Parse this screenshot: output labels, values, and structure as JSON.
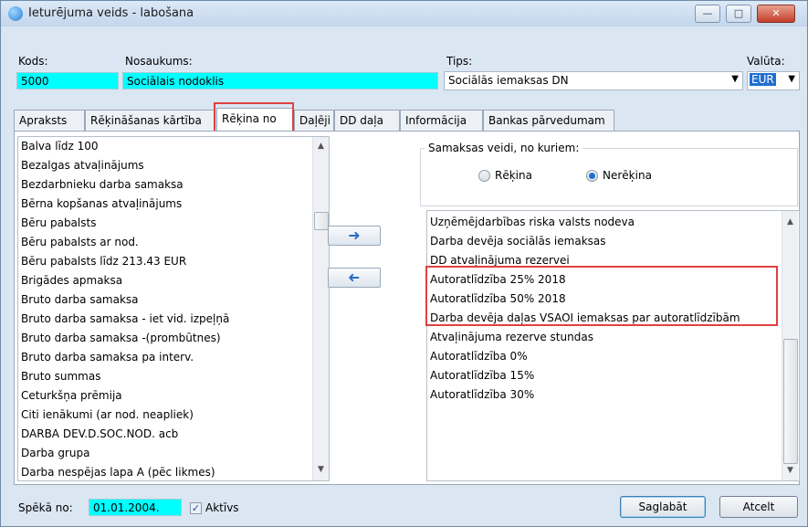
{
  "window": {
    "title": "Ieturējuma veids - labošana"
  },
  "header": {
    "kods_label": "Kods:",
    "kods_value": "5000",
    "nosaukums_label": "Nosaukums:",
    "nosaukums_value": "Sociālais nodoklis",
    "tips_label": "Tips:",
    "tips_value": "Sociālās iemaksas DN",
    "valuta_label": "Valūta:",
    "valuta_value": "EUR"
  },
  "tabs": [
    "Apraksts",
    "Rēķināšanas kārtība",
    "Rēķina no",
    "Daļēji",
    "DD daļa",
    "Informācija",
    "Bankas pārvedumam"
  ],
  "active_tab": "Rēķina no",
  "left_list": [
    "Balva līdz 100",
    "Bezalgas atvaļinājums",
    "Bezdarbnieku darba samaksa",
    "Bērna kopšanas atvaļinājums",
    "Bēru pabalsts",
    "Bēru pabalsts ar nod.",
    "Bēru pabalsts līdz 213.43 EUR",
    "Brigādes apmaksa",
    "Bruto darba samaksa",
    "Bruto darba samaksa - iet vid. izpeļņā",
    "Bruto darba samaksa -(prombūtnes)",
    "Bruto darba samaksa pa interv.",
    "Bruto summas",
    "Ceturkšņa  prēmija",
    "Citi ienākumi (ar nod. neapliek)",
    "DARBA DEV.D.SOC.NOD. acb",
    "Darba grupa",
    "Darba nespējas lapa A (pēc likmes)"
  ],
  "move_buttons": {
    "add_icon": "arrow-right-icon",
    "remove_icon": "arrow-left-icon"
  },
  "payment_group": {
    "title": "Samaksas veidi, no kuriem:",
    "option_1": "Rēķina",
    "option_2": "Nerēķina",
    "selected": "Nerēķina"
  },
  "right_list": [
    "Uzņēmējdarbības riska valsts nodeva",
    "Darba devēja sociālās iemaksas",
    "DD atvaļinājuma rezervei",
    "Autoratlīdzība 25% 2018",
    "Autoratlīdzība 50% 2018",
    "Darba devēja daļas VSAOI iemaksas par autoratlīdzībām",
    "Atvaļinājuma rezerve stundas",
    "Autoratlīdzība 0%",
    "Autoratlīdzība 15%",
    "Autoratlīdzība 30%"
  ],
  "footer": {
    "speka_label": "Spēkā no:",
    "speka_value": "01.01.2004.",
    "aktivs_label": "Aktīvs",
    "aktivs_checked": true,
    "save_label": "Saglabāt",
    "cancel_label": "Atcelt"
  },
  "colors": {
    "field_bg": "#00ffff",
    "highlight": "#e04040",
    "selected_blue": "#1f6fd1"
  }
}
